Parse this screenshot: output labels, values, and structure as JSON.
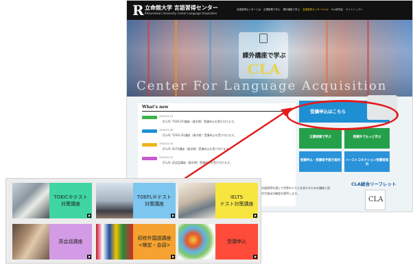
{
  "site": {
    "logo_mark": "R",
    "title": "立命館大学 言語習得センター",
    "subtitle": "Ritsumeikan University Center Language Acquisition",
    "nav": [
      "言語習得センターとは",
      "正課授業で学ぶ",
      "課外講座で学ぶ",
      "言語習得センター(CLA)",
      "CLA研究会",
      "サイトトップへ"
    ],
    "hero": {
      "jp": "課外講座で学ぶ",
      "brand": "CLA",
      "en": "Center For Language Acquisition"
    },
    "news": {
      "title": "What's new",
      "items": [
        {
          "date": "2016.04.15",
          "text": "【CLA】TOEIC(R)講座（春学期）受講申込を受け付けます。",
          "tag_color": "#3bb44a"
        },
        {
          "date": "2016.04.08",
          "text": "【CLA】TOEFL(R)講座（春学期）受講申込を受け付けます。",
          "tag_color": "#1f8fd4"
        },
        {
          "date": "2016.04.04",
          "text": "【CLA】IELTS講座（春学期）受講申込を受け付けます。",
          "tag_color": "#f0b21a"
        },
        {
          "date": "2016.04.01",
          "text": "【CLA】英会話講座（春学期）受講申込を受け付けます。",
          "tag_color": "#c65ad0"
        }
      ]
    },
    "side": {
      "apply": "受講申込はこちら",
      "green_a": "正課授業で学ぶ",
      "green_b": "授業外でもっと学ぶ",
      "blue_a": "受講申込・受講者手続き案内",
      "blue_b": "ハーストコネクション受講者案内"
    },
    "lower_text": "言語習得を通じて世界の人々と交流するための講座と語学力強化の機会を提供します。",
    "leaflet": {
      "title": "CLA総合リーフレット",
      "card": "CLA"
    }
  },
  "tiles": [
    {
      "label": "TOEIC®テスト\n対策講座",
      "color": "#3fd6a4"
    },
    {
      "label": "TOEFL®テスト\n対策講座",
      "color": "#7cc6f0"
    },
    {
      "label": "IELTS\nテスト対策講座",
      "color": "#f8e640"
    },
    {
      "label": "英会話講座",
      "color": "#d39ae6"
    },
    {
      "label": "初修外国語講座\n<検定・会話>",
      "color": "#f5a230"
    },
    {
      "label": "受講申込",
      "color": "#ff4b3a"
    }
  ]
}
